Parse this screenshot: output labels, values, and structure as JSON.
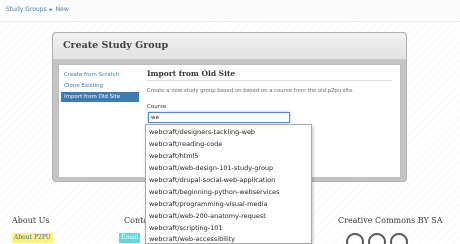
{
  "breadcrumb": {
    "parent": "Study Groups",
    "separator": "▸",
    "current": "New"
  },
  "card": {
    "title": "Create Study Group"
  },
  "sidebar": {
    "items": [
      {
        "label": "Create from Scratch",
        "active": false
      },
      {
        "label": "Clone Existing",
        "active": false
      },
      {
        "label": "Import from Old Site",
        "active": true
      }
    ]
  },
  "panel": {
    "title": "Import from Old Site",
    "description": "Create a new study group based on based on a course from the old p2pu site.",
    "course_label": "Course",
    "course_value": "we"
  },
  "autocomplete": {
    "items": [
      "webcraft/designers-tackling-web",
      "webcraft/reading-code",
      "webcraft/html5",
      "webcraft/web-design-101-study-group",
      "webcraft/drupal-social-web-application",
      "webcraft/beginning-python-webservices",
      "webcraft/programming-visual-media",
      "webcraft/web-200-anatomy-request",
      "webcraft/scripting-101",
      "webcraft/web-accessibility"
    ]
  },
  "footer": {
    "about_heading": "About Us",
    "about_link": "About P2PU",
    "contact_heading": "Conta",
    "contact_link": "Email",
    "cc_heading": "Creative Commons BY SA",
    "cc_icons": [
      "cc-icon",
      "by-icon",
      "sa-icon"
    ]
  },
  "colors": {
    "link": "#3d7bb0",
    "active_nav": "#3d7bb0",
    "tag_yellow": "#fff27a",
    "tag_cyan": "#5fd8d8"
  }
}
